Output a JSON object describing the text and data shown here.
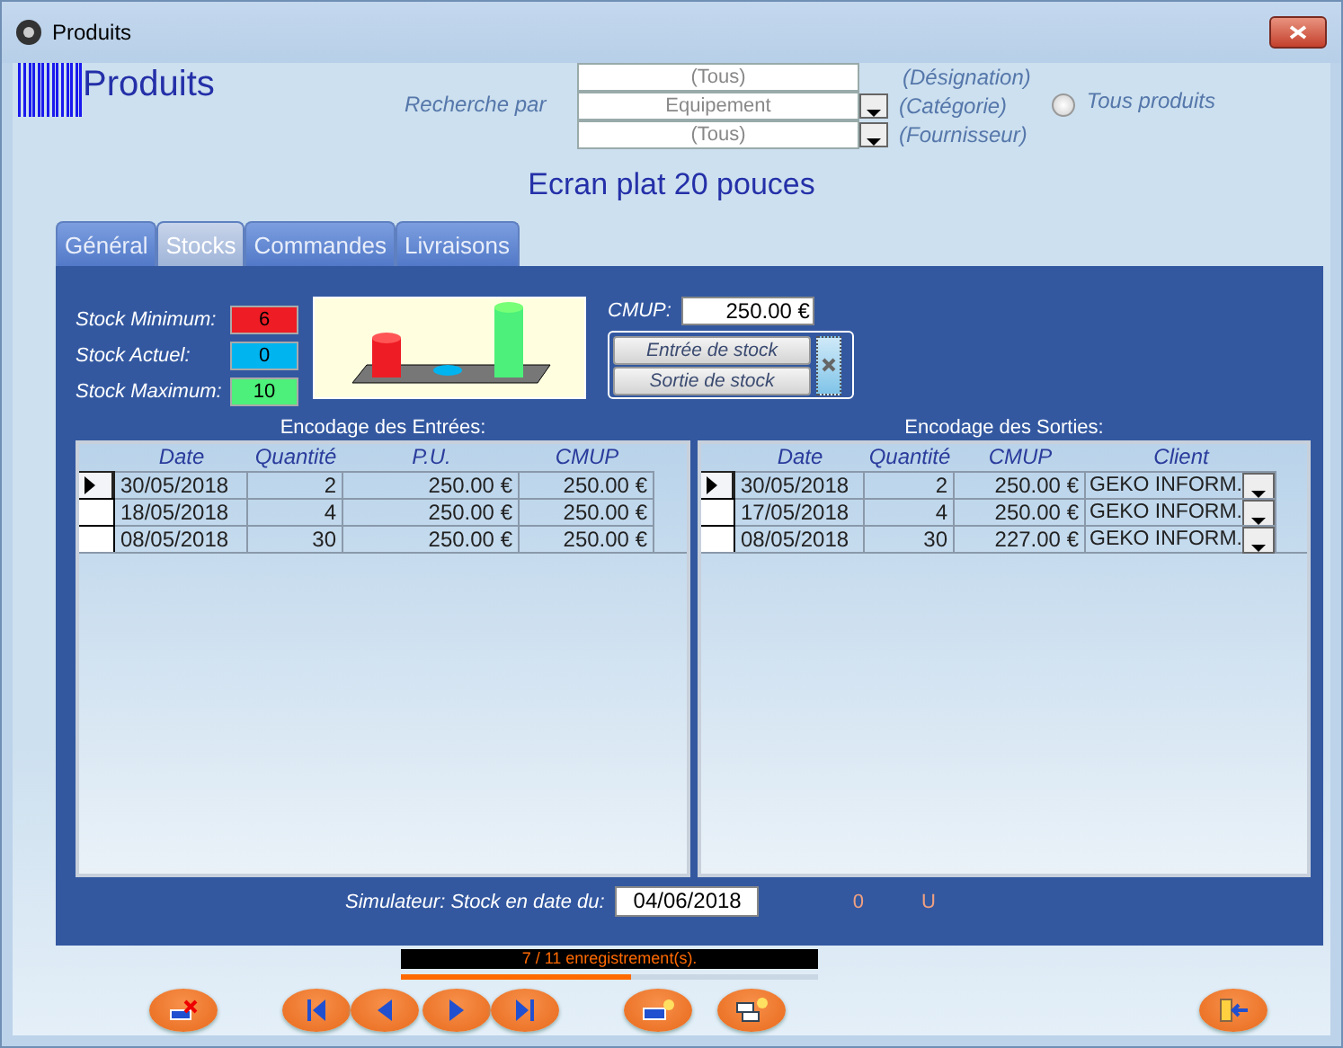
{
  "window": {
    "title": "Produits"
  },
  "header": {
    "title": "Produits"
  },
  "search": {
    "label": "Recherche par",
    "fields": [
      {
        "kind": "text",
        "value": "(Tous)",
        "hint": "(Désignation)"
      },
      {
        "kind": "combo",
        "value": "Equipement",
        "hint": "(Catégorie)"
      },
      {
        "kind": "combo",
        "value": "(Tous)",
        "hint": "(Fournisseur)"
      }
    ],
    "all_products": {
      "label": "Tous produits",
      "selected": false
    }
  },
  "product_name": "Ecran plat 20 pouces",
  "tabs": [
    {
      "label": "Général",
      "selected": false
    },
    {
      "label": "Stocks",
      "selected": true
    },
    {
      "label": "Commandes",
      "selected": false
    },
    {
      "label": "Livraisons",
      "selected": false
    }
  ],
  "stock_levels": [
    {
      "label": "Stock Minimum:",
      "value": "6",
      "color": "#ee1c24"
    },
    {
      "label": "Stock Actuel:",
      "value": "0",
      "color": "#00b4f0"
    },
    {
      "label": "Stock Maximum:",
      "value": "10",
      "color": "#4cf07a"
    }
  ],
  "cmup": {
    "label": "CMUP:",
    "value": "250.00 €"
  },
  "stock_buttons": [
    "Entrée de stock",
    "Sortie de stock"
  ],
  "entries": {
    "title": "Encodage des Entrées:",
    "columns": [
      "Date",
      "Quantité",
      "P.U.",
      "CMUP"
    ],
    "rows": [
      {
        "selected": true,
        "cells": [
          "30/05/2018",
          "2",
          "250.00 €",
          "250.00 €"
        ]
      },
      {
        "selected": false,
        "cells": [
          "18/05/2018",
          "4",
          "250.00 €",
          "250.00 €"
        ]
      },
      {
        "selected": false,
        "cells": [
          "08/05/2018",
          "30",
          "250.00 €",
          "250.00 €"
        ]
      }
    ]
  },
  "exits": {
    "title": "Encodage des Sorties:",
    "columns": [
      "Date",
      "Quantité",
      "CMUP",
      "Client"
    ],
    "rows": [
      {
        "selected": true,
        "cells": [
          "30/05/2018",
          "2",
          "250.00 €",
          "GEKO INFORM."
        ]
      },
      {
        "selected": false,
        "cells": [
          "17/05/2018",
          "4",
          "250.00 €",
          "GEKO INFORM."
        ]
      },
      {
        "selected": false,
        "cells": [
          "08/05/2018",
          "30",
          "227.00 €",
          "GEKO INFORM."
        ]
      }
    ]
  },
  "simulator": {
    "label": "Simulateur: Stock en date du:",
    "date": "04/06/2018",
    "quantity": "0",
    "unit": "U"
  },
  "status": {
    "text": "7 / 11 enregistrement(s).",
    "level": 0.55
  }
}
